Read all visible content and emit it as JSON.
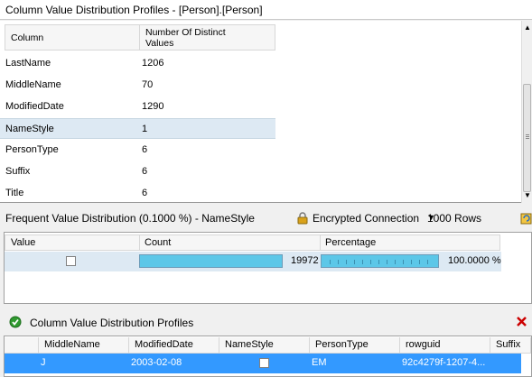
{
  "top": {
    "title": "Column Value Distribution Profiles  -  [Person].[Person]",
    "columns": [
      "Column",
      "Number Of Distinct\nValues"
    ],
    "rows": [
      {
        "column": "LastName",
        "value": "1206"
      },
      {
        "column": "MiddleName",
        "value": "70"
      },
      {
        "column": "ModifiedDate",
        "value": "1290"
      },
      {
        "column": "NameStyle",
        "value": "1"
      },
      {
        "column": "PersonType",
        "value": "6"
      },
      {
        "column": "Suffix",
        "value": "6"
      },
      {
        "column": "Title",
        "value": "6"
      }
    ],
    "selected_row": 3
  },
  "freq": {
    "title": "Frequent Value Distribution (0.1000 %) - NameStyle",
    "encrypted_label": "Encrypted Connection",
    "rows_option": "1000 Rows",
    "columns": [
      "Value",
      "Count",
      "Percentage"
    ],
    "row": {
      "count": "19972",
      "percentage": "100.0000 %",
      "fraction": 1.0
    }
  },
  "bottom": {
    "title": "Column Value Distribution Profiles",
    "columns": [
      "MiddleName",
      "ModifiedDate",
      "NameStyle",
      "PersonType",
      "rowguid",
      "Suffix"
    ],
    "row": {
      "middlename": "J",
      "modifieddate": "2003-02-08",
      "persontype": "EM",
      "rowguid": "92c4279f-1207-4..."
    }
  },
  "colors": {
    "accent": "#3399ff",
    "bar": "#5cc7e8",
    "selected": "#dde9f3",
    "close": "#cc0000",
    "ok": "#2f9a2f"
  }
}
